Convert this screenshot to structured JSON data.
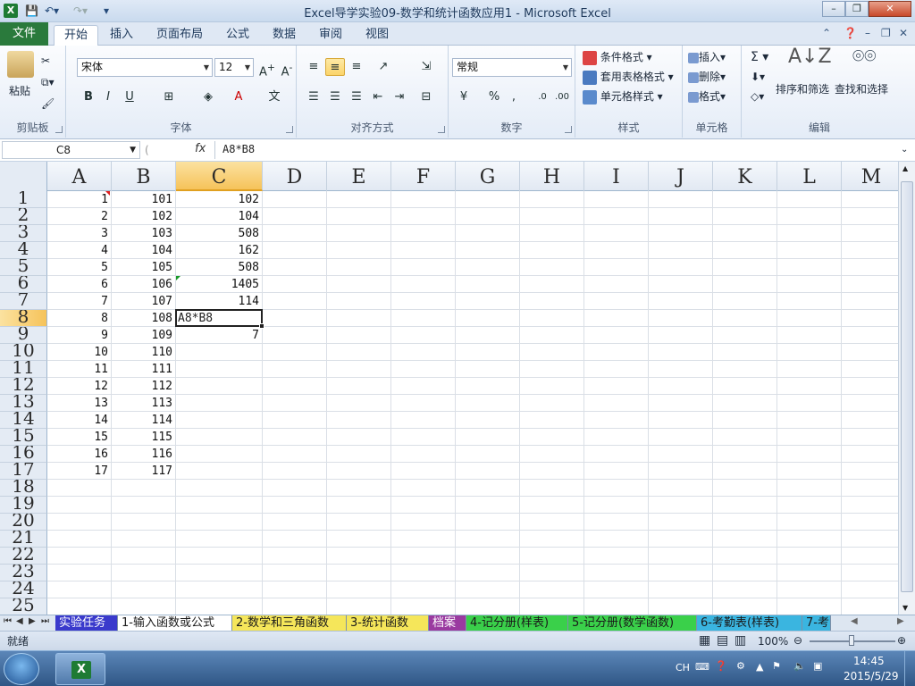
{
  "window": {
    "title": "Excel导学实验09-数学和统计函数应用1 - Microsoft Excel",
    "minimize": "–",
    "maximize": "❐",
    "close": "✕"
  },
  "ribbon_tabs": {
    "file": "文件",
    "items": [
      "开始",
      "插入",
      "页面布局",
      "公式",
      "数据",
      "审阅",
      "视图"
    ]
  },
  "ribbon": {
    "clipboard": {
      "label": "剪贴板",
      "paste": "粘贴"
    },
    "font": {
      "label": "字体",
      "name": "宋体",
      "size": "12"
    },
    "alignment": {
      "label": "对齐方式"
    },
    "number": {
      "label": "数字",
      "format": "常规",
      "percent": "%",
      "comma": ","
    },
    "styles": {
      "label": "样式",
      "conditional": "条件格式",
      "table": "套用表格格式",
      "cell": "单元格样式"
    },
    "cells": {
      "label": "单元格",
      "insert": "插入",
      "delete": "删除",
      "format": "格式"
    },
    "editing": {
      "label": "编辑",
      "sort": "排序和筛选",
      "find": "查找和选择"
    }
  },
  "formula_bar": {
    "name_box": "C8",
    "fx": "fx",
    "formula": "A8*B8"
  },
  "columns": [
    "A",
    "B",
    "C",
    "D",
    "E",
    "F",
    "G",
    "H",
    "I",
    "J",
    "K",
    "L",
    "M"
  ],
  "rows": [
    "1",
    "2",
    "3",
    "4",
    "5",
    "6",
    "7",
    "8",
    "9",
    "10",
    "11",
    "12",
    "13",
    "14",
    "15",
    "16",
    "17",
    "18",
    "19",
    "20",
    "21",
    "22",
    "23",
    "24",
    "25"
  ],
  "cells": {
    "A": [
      "1",
      "2",
      "3",
      "4",
      "5",
      "6",
      "7",
      "8",
      "9",
      "10",
      "11",
      "12",
      "13",
      "14",
      "15",
      "16",
      "17"
    ],
    "B": [
      "101",
      "102",
      "103",
      "104",
      "105",
      "106",
      "107",
      "108",
      "109",
      "110",
      "111",
      "112",
      "113",
      "114",
      "115",
      "116",
      "117"
    ],
    "C": [
      "102",
      "104",
      "508",
      "162",
      "508",
      "1405",
      "114",
      "",
      "7"
    ]
  },
  "active_cell": {
    "ref": "C8",
    "text": "A8*B8"
  },
  "sheet_tabs": [
    {
      "label": "实验任务",
      "color": "#3a3acc"
    },
    {
      "label": "1-输入函数或公式",
      "color": "#ffffff"
    },
    {
      "label": "2-数学和三角函数",
      "color": "#f5e65a"
    },
    {
      "label": "3-统计函数",
      "color": "#f5e65a"
    },
    {
      "label": "档案",
      "color": "#9a3aa0"
    },
    {
      "label": "4-记分册(样表)",
      "color": "#3ad04a"
    },
    {
      "label": "5-记分册(数学函数)",
      "color": "#3ad04a"
    },
    {
      "label": "6-考勤表(样表)",
      "color": "#3ab5e0"
    },
    {
      "label": "7-考",
      "color": "#3ab5e0"
    }
  ],
  "status": {
    "ready": "就绪",
    "zoom": "100%"
  },
  "taskbar": {
    "ime": "CH",
    "time": "14:45",
    "date": "2015/5/29"
  }
}
